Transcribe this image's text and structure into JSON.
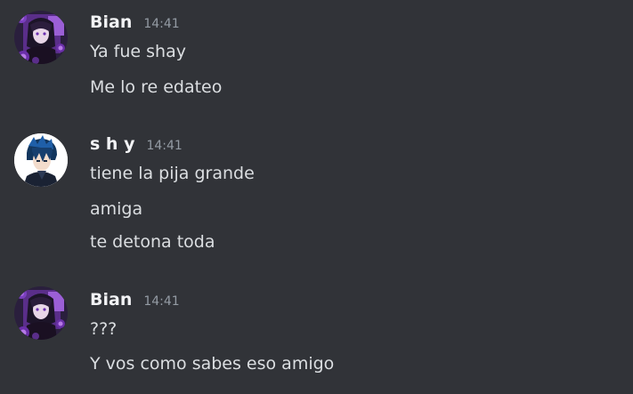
{
  "groups": [
    {
      "author": "Bian",
      "time": "14:41",
      "avatar_icon": "anime-girl-purple-roses-avatar",
      "messages": [
        "Ya fue shay",
        "Me lo re edateo"
      ]
    },
    {
      "author": "s h y",
      "time": "14:41",
      "avatar_icon": "anime-boy-blue-hair-avatar",
      "messages": [
        "tiene la pija grande",
        "amiga",
        "te detona toda"
      ]
    },
    {
      "author": "Bian",
      "time": "14:41",
      "avatar_icon": "anime-girl-purple-roses-avatar",
      "messages": [
        "???",
        "Y vos como sabes eso amigo"
      ]
    }
  ],
  "colors": {
    "background": "#313338",
    "username": "#f2f3f5",
    "timestamp": "#949ba4",
    "message_text": "#dbdee1",
    "avatar_purple": "#7a3fbf",
    "avatar_blue": "#1f5fa8"
  }
}
